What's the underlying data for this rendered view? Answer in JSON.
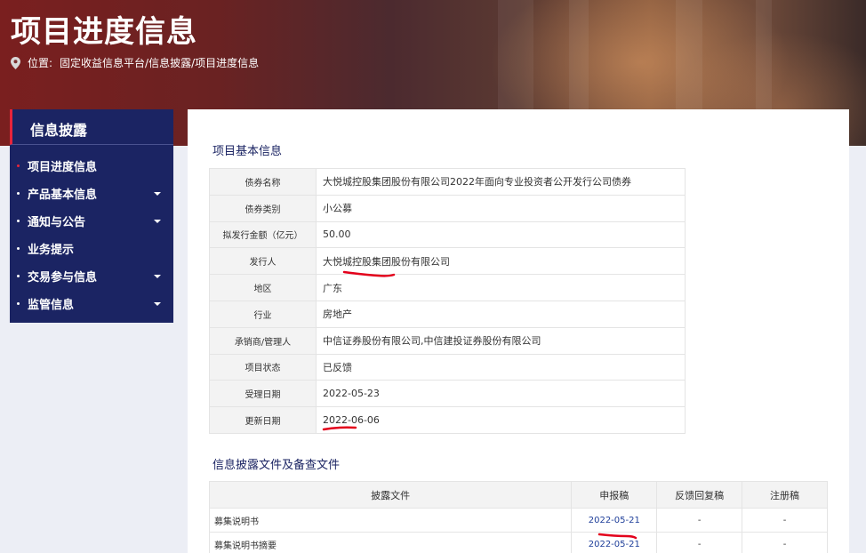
{
  "header": {
    "title": "项目进度信息",
    "location_label": "位置:",
    "breadcrumb": "固定收益信息平台/信息披露/项目进度信息"
  },
  "sidebar": {
    "title": "信息披露",
    "items": [
      {
        "label": "项目进度信息",
        "active": true,
        "has_submenu": false
      },
      {
        "label": "产品基本信息",
        "active": false,
        "has_submenu": true
      },
      {
        "label": "通知与公告",
        "active": false,
        "has_submenu": true
      },
      {
        "label": "业务提示",
        "active": false,
        "has_submenu": false
      },
      {
        "label": "交易参与信息",
        "active": false,
        "has_submenu": true
      },
      {
        "label": "监管信息",
        "active": false,
        "has_submenu": true
      }
    ]
  },
  "basic_info": {
    "title": "项目基本信息",
    "rows": [
      {
        "key": "债券名称",
        "value": "大悦城控股集团股份有限公司2022年面向专业投资者公开发行公司债券"
      },
      {
        "key": "债券类别",
        "value": "小公募"
      },
      {
        "key": "拟发行金额（亿元）",
        "value": "50.00"
      },
      {
        "key": "发行人",
        "value": "大悦城控股集团股份有限公司"
      },
      {
        "key": "地区",
        "value": "广东"
      },
      {
        "key": "行业",
        "value": "房地产"
      },
      {
        "key": "承销商/管理人",
        "value": "中信证券股份有限公司,中信建投证券股份有限公司"
      },
      {
        "key": "项目状态",
        "value": "已反馈"
      },
      {
        "key": "受理日期",
        "value": "2022-05-23"
      },
      {
        "key": "更新日期",
        "value": "2022-06-06"
      }
    ]
  },
  "files": {
    "title": "信息披露文件及备查文件",
    "columns": [
      "披露文件",
      "申报稿",
      "反馈回复稿",
      "注册稿"
    ],
    "rows": [
      {
        "name": "募集说明书",
        "declare": "2022-05-21",
        "feedback": "-",
        "register": "-"
      },
      {
        "name": "募集说明书摘要",
        "declare": "2022-05-21",
        "feedback": "-",
        "register": "-"
      }
    ]
  },
  "colors": {
    "sidebar_bg": "#1b2463",
    "accent_red": "#e8243a",
    "link": "#1f3f9a",
    "annotation_red": "#e3001b"
  },
  "icons": {
    "location": "map-pin-icon",
    "submenu": "caret-down-icon"
  }
}
